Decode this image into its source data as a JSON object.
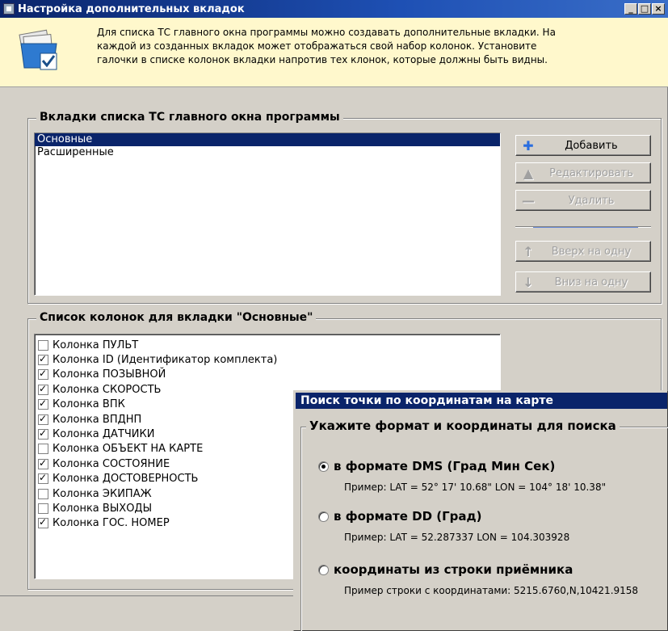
{
  "main_window": {
    "title": "Настройка дополнительных вкладок",
    "info_text": "Для списка ТС главного окна программы можно создавать дополнительные вкладки. На\nкаждой из созданных вкладок может отображаться свой набор колонок. Установите\nгалочки в списке колонок вкладки напротив тех клонок, которые должны быть видны.",
    "tabs_group_title": "Вкладки списка ТС главного окна программы",
    "tabs": [
      "Основные",
      "Расширенные"
    ],
    "selected_tab": "Основные",
    "buttons": {
      "add": "Добавить",
      "edit": "Редактировать",
      "delete": "Удалить",
      "up": "Вверх на одну",
      "down": "Вниз на одну"
    },
    "columns_group_title": "Список колонок для вкладки \"Основные\"",
    "columns": [
      {
        "label": "Колонка ПУЛЬТ",
        "checked": false
      },
      {
        "label": "Колонка ID (Идентификатор комплекта)",
        "checked": true
      },
      {
        "label": "Колонка ПОЗЫВНОЙ",
        "checked": true
      },
      {
        "label": "Колонка СКОРОСТЬ",
        "checked": true
      },
      {
        "label": "Колонка ВПК",
        "checked": true
      },
      {
        "label": "Колонка ВПДНП",
        "checked": true
      },
      {
        "label": "Колонка ДАТЧИКИ",
        "checked": true
      },
      {
        "label": "Колонка ОБЪЕКТ НА КАРТЕ",
        "checked": false
      },
      {
        "label": "Колонка СОСТОЯНИЕ",
        "checked": true
      },
      {
        "label": "Колонка ДОСТОВЕРНОСТЬ",
        "checked": true
      },
      {
        "label": "Колонка ЭКИПАЖ",
        "checked": false
      },
      {
        "label": "Колонка ВЫХОДЫ",
        "checked": false
      },
      {
        "label": "Колонка ГОС. НОМЕР",
        "checked": true
      }
    ]
  },
  "search_dialog": {
    "title": "Поиск точки по координатам на карте",
    "group_title": "Укажите формат и координаты для поиска",
    "options": [
      {
        "label": "в формате DMS (Град Мин Сек)",
        "example": "Пример: LAT = 52° 17' 10.68\"  LON = 104° 18' 10.38\"",
        "selected": true
      },
      {
        "label": "в формате DD (Град)",
        "example": "Пример:  LAT = 52.287337  LON = 104.303928",
        "selected": false
      },
      {
        "label": "координаты из строки приёмника",
        "example": "Пример строки с координатами:  5215.6760,N,10421.9158",
        "selected": false
      }
    ]
  }
}
